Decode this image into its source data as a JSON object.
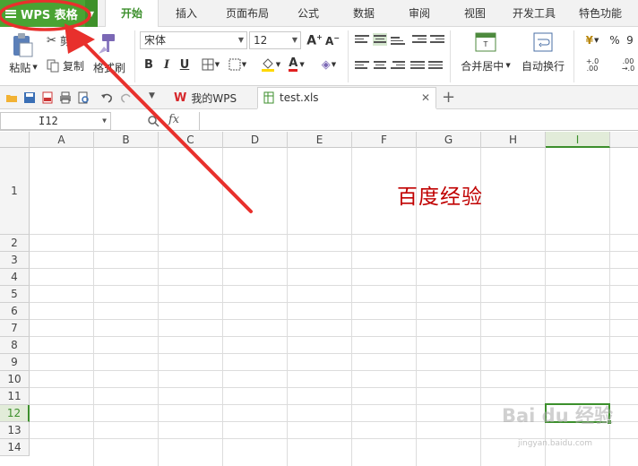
{
  "app": {
    "name": "WPS 表格",
    "colors": {
      "brand": "#4aa333",
      "accent": "#3c8f2c",
      "annotation": "#e8302c",
      "cell_text": "#c00000"
    }
  },
  "menu": {
    "tabs": [
      {
        "label": "开始",
        "active": true
      },
      {
        "label": "插入"
      },
      {
        "label": "页面布局"
      },
      {
        "label": "公式"
      },
      {
        "label": "数据"
      },
      {
        "label": "审阅"
      },
      {
        "label": "视图"
      },
      {
        "label": "开发工具"
      },
      {
        "label": "特色功能"
      }
    ]
  },
  "ribbon": {
    "paste_label": "粘贴",
    "cut_label": "剪",
    "copy_label": "复制",
    "format_painter_label": "格式刷",
    "font_name": "宋体",
    "font_size": "12",
    "bold": "B",
    "italic": "I",
    "underline": "U",
    "font_color_glyph": "A",
    "merge_center_label": "合并居中",
    "wrap_text_label": "自动换行",
    "number_format_glyph": "¥",
    "percent_glyph": "%",
    "thousands_glyph": "9",
    "inc_decimal_glyph": "+.0 .00",
    "dec_decimal_glyph": ".00 →.0"
  },
  "doc_tabs": [
    {
      "label": "我的WPS",
      "icon": "wps-logo-icon"
    },
    {
      "label": "test.xls",
      "icon": "spreadsheet-file-icon",
      "active": true
    }
  ],
  "formula_bar": {
    "name_box": "I12",
    "fx": "fx",
    "value": ""
  },
  "grid": {
    "columns": [
      "A",
      "B",
      "C",
      "D",
      "E",
      "F",
      "G",
      "H",
      "I"
    ],
    "selected_column": "I",
    "rows": [
      "1",
      "2",
      "3",
      "4",
      "5",
      "6",
      "7",
      "8",
      "9",
      "10",
      "11",
      "12",
      "13",
      "14"
    ],
    "selected_row": "12",
    "cells": {
      "F1": "百度经验"
    },
    "selected_cell": "I12"
  },
  "watermark": {
    "brand": "Bai du 经验",
    "url": "jingyan.baidu.com"
  }
}
